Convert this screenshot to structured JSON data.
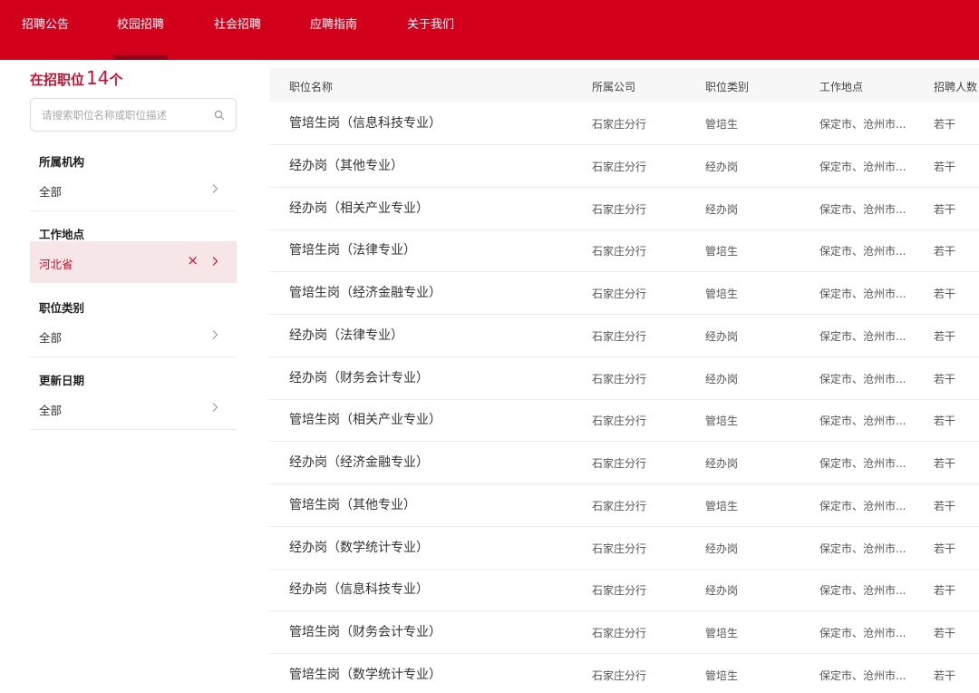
{
  "nav": {
    "items": [
      "招聘公告",
      "校园招聘",
      "社会招聘",
      "应聘指南",
      "关于我们"
    ],
    "active_index": 1
  },
  "colors": {
    "brand": "#d3001b",
    "accent": "#c8102e",
    "selected_bg": "#f7e6e8"
  },
  "sidebar": {
    "count_label": "在招职位",
    "count_value": "14",
    "count_unit": "个",
    "search_placeholder": "请搜索职位名称或职位描述",
    "search_icon": "search-icon",
    "filters": [
      {
        "title": "所属机构",
        "value": "全部",
        "selected": false
      },
      {
        "title": "工作地点",
        "value": "河北省",
        "selected": true,
        "clear_label": "×"
      },
      {
        "title": "职位类别",
        "value": "全部",
        "selected": false
      },
      {
        "title": "更新日期",
        "value": "全部",
        "selected": false
      }
    ]
  },
  "table": {
    "headers": [
      "职位名称",
      "所属公司",
      "职位类别",
      "工作地点",
      "招聘人数"
    ],
    "rows": [
      [
        "管培生岗（信息科技专业）",
        "石家庄分行",
        "管培生",
        "保定市、沧州市...",
        "若干"
      ],
      [
        "经办岗（其他专业）",
        "石家庄分行",
        "经办岗",
        "保定市、沧州市...",
        "若干"
      ],
      [
        "经办岗（相关产业专业）",
        "石家庄分行",
        "经办岗",
        "保定市、沧州市...",
        "若干"
      ],
      [
        "管培生岗（法律专业）",
        "石家庄分行",
        "管培生",
        "保定市、沧州市...",
        "若干"
      ],
      [
        "管培生岗（经济金融专业）",
        "石家庄分行",
        "管培生",
        "保定市、沧州市...",
        "若干"
      ],
      [
        "经办岗（法律专业）",
        "石家庄分行",
        "经办岗",
        "保定市、沧州市...",
        "若干"
      ],
      [
        "经办岗（财务会计专业）",
        "石家庄分行",
        "经办岗",
        "保定市、沧州市...",
        "若干"
      ],
      [
        "管培生岗（相关产业专业）",
        "石家庄分行",
        "管培生",
        "保定市、沧州市...",
        "若干"
      ],
      [
        "经办岗（经济金融专业）",
        "石家庄分行",
        "经办岗",
        "保定市、沧州市...",
        "若干"
      ],
      [
        "管培生岗（其他专业）",
        "石家庄分行",
        "管培生",
        "保定市、沧州市...",
        "若干"
      ],
      [
        "经办岗（数学统计专业）",
        "石家庄分行",
        "经办岗",
        "保定市、沧州市...",
        "若干"
      ],
      [
        "经办岗（信息科技专业）",
        "石家庄分行",
        "经办岗",
        "保定市、沧州市...",
        "若干"
      ],
      [
        "管培生岗（财务会计专业）",
        "石家庄分行",
        "管培生",
        "保定市、沧州市...",
        "若干"
      ],
      [
        "管培生岗（数学统计专业）",
        "石家庄分行",
        "管培生",
        "保定市、沧州市...",
        "若干"
      ]
    ]
  }
}
